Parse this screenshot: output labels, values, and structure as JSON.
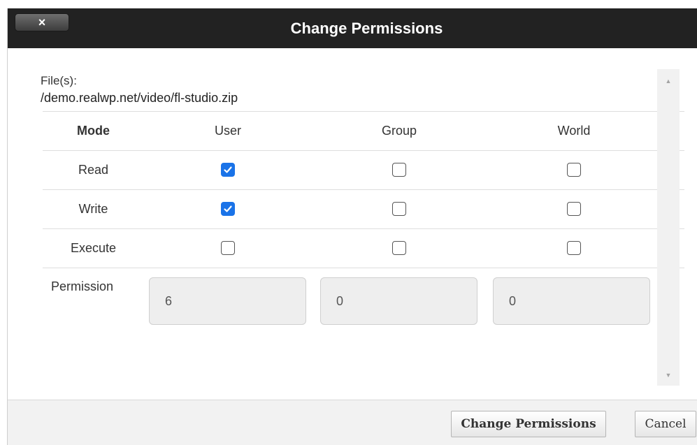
{
  "dialog": {
    "title": "Change Permissions",
    "close_label": "×"
  },
  "files": {
    "label": "File(s):",
    "path": "/demo.realwp.net/video/fl-studio.zip"
  },
  "table": {
    "headers": {
      "mode": "Mode",
      "user": "User",
      "group": "Group",
      "world": "World"
    },
    "rows": [
      {
        "label": "Read",
        "user": true,
        "group": false,
        "world": false
      },
      {
        "label": "Write",
        "user": true,
        "group": false,
        "world": false
      },
      {
        "label": "Execute",
        "user": false,
        "group": false,
        "world": false
      }
    ]
  },
  "permission": {
    "label": "Permission",
    "user": "6",
    "group": "0",
    "world": "0"
  },
  "footer": {
    "change_label": "Change Permissions",
    "cancel_label": "Cancel"
  },
  "colors": {
    "titlebar": "#222222",
    "checkbox_checked": "#1a73e8"
  }
}
